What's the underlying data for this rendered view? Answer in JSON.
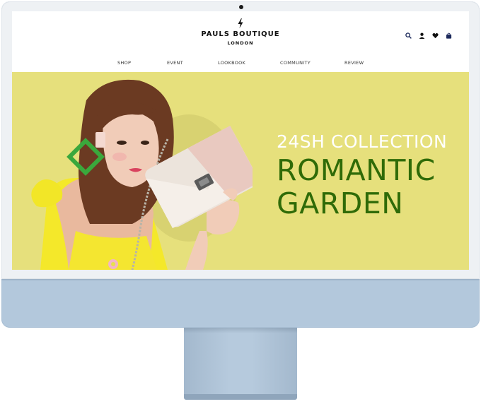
{
  "site": {
    "brand": "PAULS BOUTIQUE",
    "brand_sub": "LONDON",
    "icons": [
      "search-icon",
      "user-icon",
      "heart-icon",
      "bag-icon"
    ]
  },
  "nav": {
    "items": [
      {
        "label": "SHOP"
      },
      {
        "label": "EVENT"
      },
      {
        "label": "LOOKBOOK"
      },
      {
        "label": "COMMUNITY"
      },
      {
        "label": "REVIEW"
      }
    ]
  },
  "hero": {
    "kicker": "24SH COLLECTION",
    "title": "ROMANTIC\nGARDEN",
    "background_color": "#e6e07c",
    "title_color": "#2f6b08",
    "kicker_color": "#ffffff"
  },
  "device": {
    "frame_color": "#b3c8dc",
    "bezel_color": "#eef1f4"
  }
}
